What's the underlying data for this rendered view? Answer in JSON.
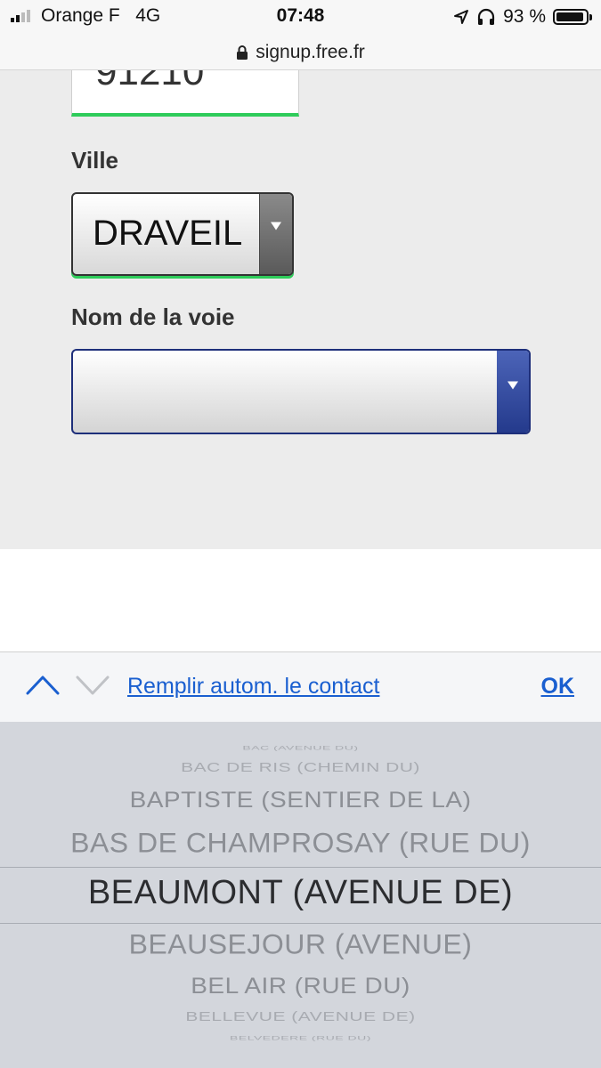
{
  "status_bar": {
    "carrier": "Orange F",
    "network": "4G",
    "time": "07:48",
    "battery_text": "93 %",
    "battery_level": 0.93
  },
  "url_bar": {
    "domain": "signup.free.fr"
  },
  "form": {
    "postal_code_value": "91210",
    "ville_label": "Ville",
    "ville_value": "DRAVEIL",
    "voie_label": "Nom de la voie",
    "voie_value": ""
  },
  "accessory_bar": {
    "autofill_label": "Remplir autom. le contact",
    "ok_label": "OK"
  },
  "picker": {
    "options": [
      "BAC (AVENUE DU)",
      "BAC DE RIS (CHEMIN DU)",
      "BAPTISTE (SENTIER DE LA)",
      "BAS DE CHAMPROSAY (RUE DU)",
      "BEAUMONT (AVENUE DE)",
      "BEAUSEJOUR (AVENUE)",
      "BEL AIR (RUE DU)",
      "BELLEVUE (AVENUE DE)",
      "BELVEDERE (RUE DU)"
    ],
    "selected": "BEAUMONT (AVENUE DE)"
  },
  "colors": {
    "accent_green": "#2ecc5a",
    "select_blue": "#243a8c",
    "link_blue": "#1a5fd0"
  }
}
